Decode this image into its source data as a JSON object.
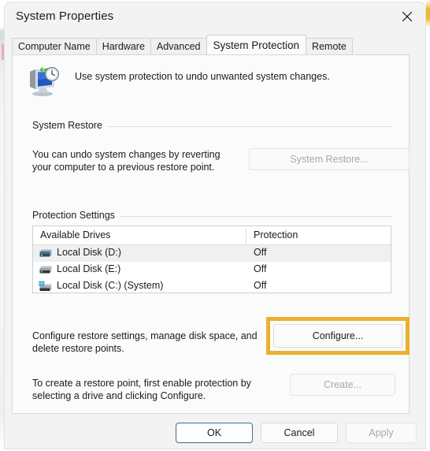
{
  "window": {
    "title": "System Properties",
    "close_icon": "close-x-icon"
  },
  "tabs": [
    {
      "label": "Computer Name",
      "active": false
    },
    {
      "label": "Hardware",
      "active": false
    },
    {
      "label": "Advanced",
      "active": false
    },
    {
      "label": "System Protection",
      "active": true
    },
    {
      "label": "Remote",
      "active": false
    }
  ],
  "header": {
    "icon": "system-restore-icon",
    "description": "Use system protection to undo unwanted system changes."
  },
  "system_restore": {
    "group_label": "System Restore",
    "description_line1": "You can undo system changes by reverting",
    "description_line2": "your computer to a previous restore point.",
    "button_label": "System Restore...",
    "button_enabled": false
  },
  "protection_settings": {
    "group_label": "Protection Settings",
    "columns": [
      "Available Drives",
      "Protection"
    ],
    "rows": [
      {
        "icon": "hard-drive-icon",
        "name": "Local Disk (D:)",
        "protection": "Off",
        "highlighted": true
      },
      {
        "icon": "hard-drive-icon",
        "name": "Local Disk (E:)",
        "protection": "Off",
        "highlighted": false
      },
      {
        "icon": "system-drive-icon",
        "name": "Local Disk (C:) (System)",
        "protection": "Off",
        "highlighted": false
      }
    ]
  },
  "configure": {
    "description_line1": "Configure restore settings, manage disk space, and",
    "description_line2": "delete restore points.",
    "button_label": "Configure...",
    "button_enabled": true,
    "highlight_color": "#eab130"
  },
  "create": {
    "description_line1": "To create a restore point, first enable protection by",
    "description_line2": "selecting a drive and clicking Configure.",
    "button_label": "Create...",
    "button_enabled": false
  },
  "footer": {
    "ok_label": "OK",
    "cancel_label": "Cancel",
    "apply_label": "Apply",
    "apply_enabled": false,
    "default_button_color": "#3d6e8f"
  }
}
